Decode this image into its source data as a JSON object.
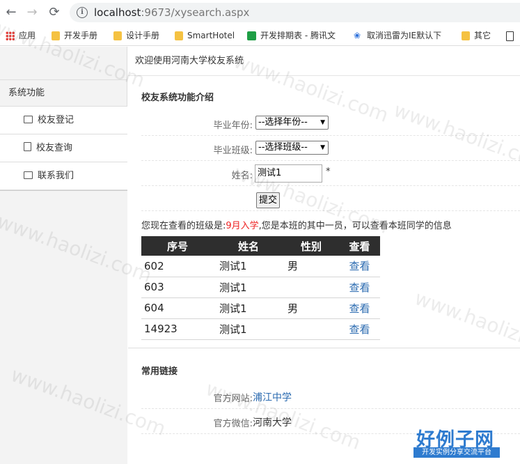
{
  "browser": {
    "back_icon": "←",
    "forward_icon": "→",
    "reload_icon": "⟳",
    "url_host": "localhost",
    "url_rest": ":9673/xysearch.aspx",
    "bookmarks": [
      {
        "label": "应用",
        "icon": "apps-grid-icon"
      },
      {
        "label": "开发手册",
        "icon": "folder-icon"
      },
      {
        "label": "设计手册",
        "icon": "folder-icon"
      },
      {
        "label": "SmartHotel",
        "icon": "folder-icon"
      },
      {
        "label": "开发排期表 - 腾讯文",
        "icon": "sheet-icon"
      },
      {
        "label": "取消迅雷为IE默认下",
        "icon": "paw-icon"
      },
      {
        "label": "其它",
        "icon": "folder-icon"
      }
    ]
  },
  "header": {
    "welcome": "欢迎使用河南大学校友系统"
  },
  "sidebar": {
    "title": "系统功能",
    "items": [
      {
        "label": "校友登记",
        "icon": "card-icon"
      },
      {
        "label": "校友查询",
        "icon": "list-icon"
      },
      {
        "label": "联系我们",
        "icon": "books-icon"
      }
    ]
  },
  "intro": {
    "title": "校友系统功能介绍",
    "year_label": "毕业年份:",
    "year_value": "--选择年份--",
    "class_label": "毕业班级:",
    "class_value": "--选择班级--",
    "name_label": "姓名:",
    "name_value": "测试1",
    "required_mark": "*",
    "submit_label": "提交"
  },
  "notice": {
    "prefix": "您现在查看的班级是:",
    "class_name": "9月入学",
    "suffix": ",您是本班的其中一员，可以查看本班同学的信息"
  },
  "table": {
    "headers": [
      "序号",
      "姓名",
      "性别",
      "查看"
    ],
    "rows": [
      {
        "id": "602",
        "name": "测试1",
        "gender": "男",
        "view": "查看"
      },
      {
        "id": "603",
        "name": "测试1",
        "gender": "",
        "view": "查看"
      },
      {
        "id": "604",
        "name": "测试1",
        "gender": "男",
        "view": "查看"
      },
      {
        "id": "14923",
        "name": "测试1",
        "gender": "",
        "view": "查看"
      }
    ]
  },
  "links": {
    "title": "常用链接",
    "website_label": "官方网站:",
    "website_value": "浦江中学",
    "wechat_label": "官方微信:",
    "wechat_value": "河南大学"
  },
  "watermark": {
    "text": "www.haolizi.com"
  },
  "stamp": {
    "title": "好例子网",
    "subtitle": "开发实例分享交流平台"
  },
  "colors": {
    "accent_link": "#2a6ab0",
    "highlight_red": "#e22222",
    "table_header_bg": "#2e2e2e"
  }
}
